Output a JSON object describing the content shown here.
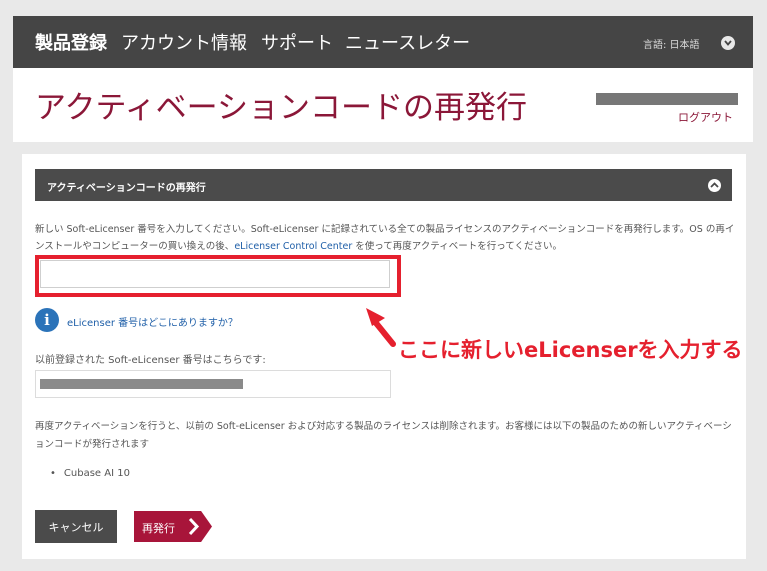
{
  "nav": {
    "items": [
      "製品登録",
      "アカウント情報",
      "サポート",
      "ニュースレター"
    ],
    "language": "言語: 日本語",
    "chevron_icon": "chevron-down-icon"
  },
  "header": {
    "title": "アクティベーションコードの再発行",
    "logout": "ログアウト"
  },
  "section": {
    "title": "アクティベーションコードの再発行",
    "intro_part1": "新しい Soft-eLicenser 番号を入力してください。Soft-eLicenser に記録されている全ての製品ライセンスのアクティベーションコードを再発行します。OS の再インストールやコンピューターの買い換えの後、",
    "intro_link": "eLicenser Control Center",
    "intro_part2": " を使って再度アクティベートを行ってください。",
    "new_input_value": "",
    "info_link": "eLicenser 番号はどこにありますか？",
    "annotation": "ここに新しいeLicenserを入力する",
    "prev_label": "以前登録された Soft-eLicenser 番号はこちらです:",
    "warning": "再度アクティベーションを行うと、以前の Soft-eLicenser および対応する製品のライセンスは削除されます。お客様には以下の製品のための新しいアクティベーションコードが発行されます",
    "products": [
      "Cubase AI 10"
    ]
  },
  "buttons": {
    "cancel": "キャンセル",
    "reissue": "再発行"
  },
  "colors": {
    "nav_bg": "#454545",
    "title": "#8b1738",
    "accent_red": "#e5202e",
    "button_red": "#a8153a",
    "link": "#1f5fa8"
  }
}
